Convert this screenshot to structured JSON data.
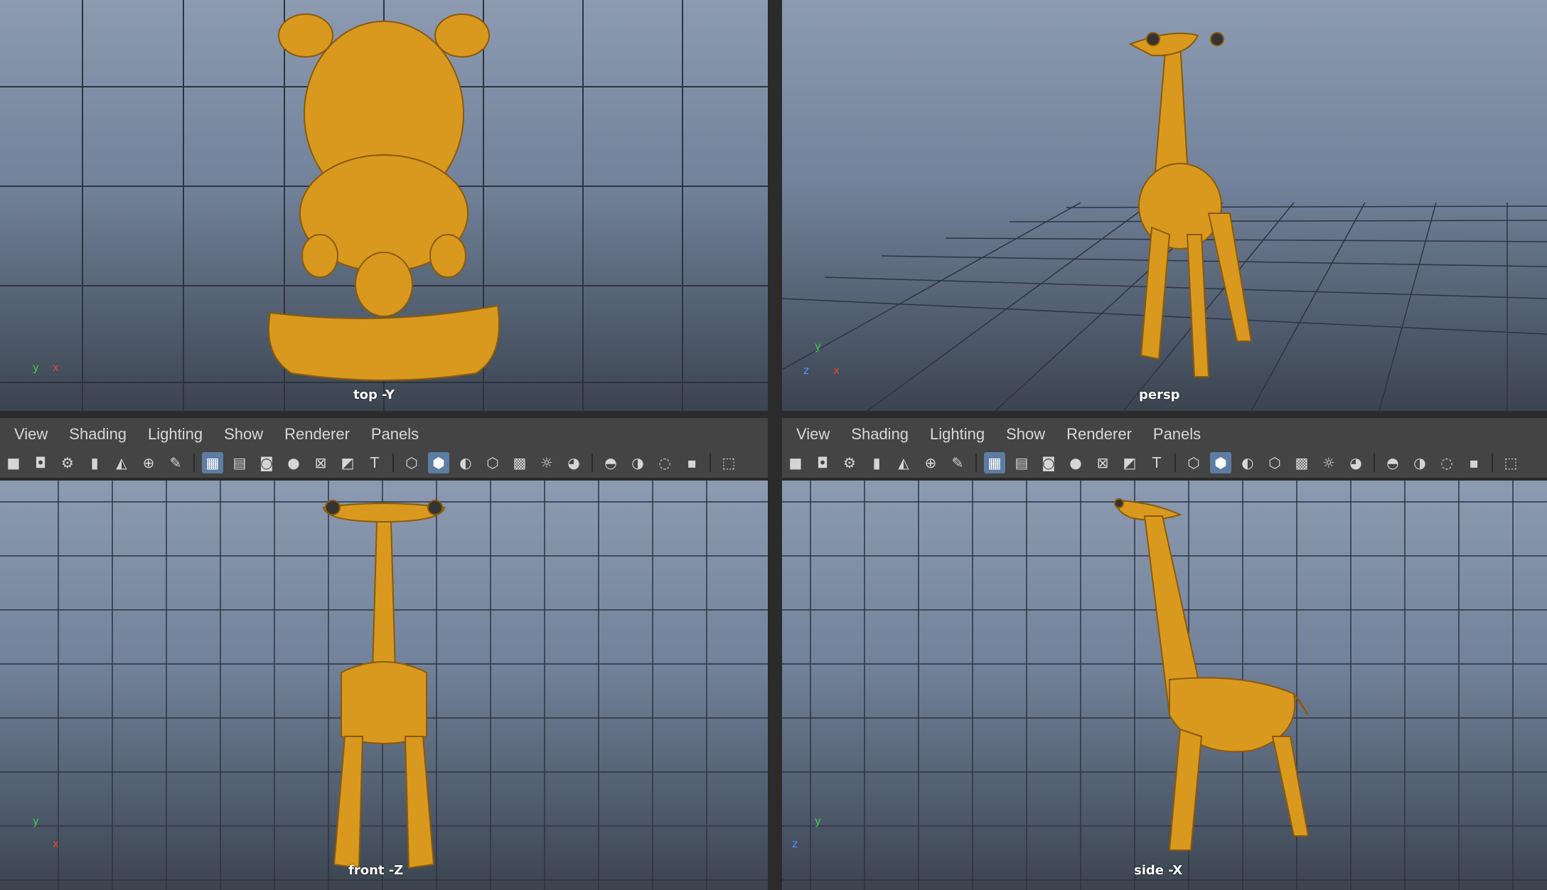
{
  "panels": {
    "top_left": {
      "label": "top -Y"
    },
    "top_right": {
      "label": "persp"
    },
    "bottom_left": {
      "label": "front -Z"
    },
    "bottom_right": {
      "label": "side -X"
    }
  },
  "menus": {
    "left": [
      "View",
      "Shading",
      "Lighting",
      "Show",
      "Renderer",
      "Panels"
    ],
    "right": [
      "View",
      "Shading",
      "Lighting",
      "Show",
      "Renderer",
      "Panels"
    ]
  },
  "axes": {
    "y": "y",
    "x": "x",
    "z": "z"
  },
  "colors": {
    "model": "#d9991e",
    "grid": "#2e3340",
    "accent_active": "#5d7da3"
  },
  "toolbar_icons": [
    "camera-icon",
    "camera-lock-icon",
    "camera-attributes-icon",
    "bookmark-icon",
    "image-plane-icon",
    "zoom-camera-icon",
    "pencil-icon",
    "grid-icon",
    "film-gate-icon",
    "resolution-gate-icon",
    "gate-mask-icon",
    "field-chart-icon",
    "safe-action-icon",
    "safe-title-icon",
    "wireframe-icon",
    "smooth-shade-icon",
    "default-material-icon",
    "shaded-wireframe-icon",
    "textured-icon",
    "lights-icon",
    "shadows-icon",
    "ambient-occlusion-icon",
    "motion-blur-icon",
    "antialias-icon",
    "isolate-select-icon",
    "xray-icon"
  ]
}
